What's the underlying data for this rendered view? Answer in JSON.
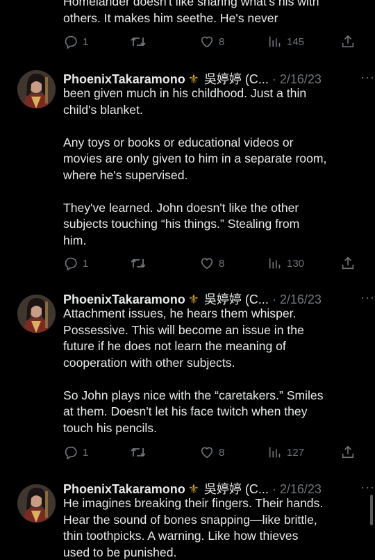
{
  "author": {
    "name": "PhoenixTakaramono",
    "emoji": "⚜",
    "suffix": "吳婷婷 (C...",
    "date": "· 2/16/23"
  },
  "partial_tweet": {
    "text": "Homelander doesn't like sharing what's his with\nothers. It makes him seethe. He's never",
    "replies": "1",
    "likes": "8",
    "views": "145"
  },
  "tweets": [
    {
      "text": "been given much in his childhood. Just a thin\nchild's blanket.\n\nAny toys or books or educational videos or\nmovies are only given to him in a separate room,\nwhere he's supervised.\n\nThey've learned. John doesn't like the other\nsubjects touching “his things.” Stealing from\nhim.",
      "replies": "1",
      "likes": "8",
      "views": "130"
    },
    {
      "text": "Attachment issues, he hears them whisper.\nPossessive. This will become an issue in the\nfuture if he does not learn the meaning of\ncooperation with other subjects.\n\nSo John plays nice with the “caretakers.” Smiles\nat them. Doesn't let his face twitch when they\ntouch his pencils.",
      "replies": "1",
      "likes": "8",
      "views": "127"
    },
    {
      "text": "He imagines breaking their fingers. Their hands.\nHear the sound of bones snapping—like brittle,\nthin toothpicks. A warning. Like how thieves\nused to be punished."
    }
  ],
  "icons": {
    "reply": "reply-icon",
    "retweet": "retweet-icon",
    "like": "like-icon",
    "views": "views-icon",
    "share": "share-icon",
    "more": "more-icon"
  },
  "colors": {
    "background": "#000000",
    "text": "#e7e9ea",
    "muted": "#71767b",
    "fleur": "#d4a32a"
  }
}
